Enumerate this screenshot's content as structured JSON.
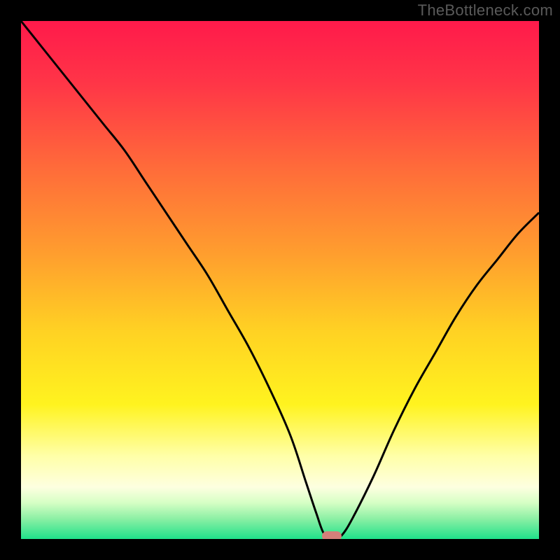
{
  "watermark": "TheBottleneck.com",
  "chart_data": {
    "type": "line",
    "title": "",
    "xlabel": "",
    "ylabel": "",
    "xlim": [
      0,
      100
    ],
    "ylim": [
      0,
      100
    ],
    "grid": false,
    "legend": false,
    "background": {
      "type": "vertical-gradient",
      "stops": [
        {
          "pct": 0,
          "color": "#ff1a4b"
        },
        {
          "pct": 12,
          "color": "#ff3547"
        },
        {
          "pct": 28,
          "color": "#ff6a3a"
        },
        {
          "pct": 45,
          "color": "#ff9e2e"
        },
        {
          "pct": 60,
          "color": "#ffd223"
        },
        {
          "pct": 74,
          "color": "#fff31f"
        },
        {
          "pct": 84,
          "color": "#ffffa8"
        },
        {
          "pct": 90,
          "color": "#fdffe0"
        },
        {
          "pct": 93,
          "color": "#d6ffc5"
        },
        {
          "pct": 96,
          "color": "#8ef0a5"
        },
        {
          "pct": 100,
          "color": "#1fe18a"
        }
      ]
    },
    "series": [
      {
        "name": "bottleneck-curve",
        "color": "#000000",
        "stroke_width": 3,
        "x": [
          0,
          4,
          8,
          12,
          16,
          20,
          24,
          28,
          32,
          36,
          40,
          44,
          48,
          52,
          55,
          57,
          58.5,
          60,
          61,
          62,
          64,
          68,
          72,
          76,
          80,
          84,
          88,
          92,
          96,
          100
        ],
        "y": [
          100,
          95,
          90,
          85,
          80,
          75,
          69,
          63,
          57,
          51,
          44,
          37,
          29,
          20,
          11,
          5,
          1,
          0.5,
          0.5,
          0.8,
          4,
          12,
          21,
          29,
          36,
          43,
          49,
          54,
          59,
          63
        ]
      }
    ],
    "marker": {
      "name": "optimal-point",
      "x": 60,
      "y": 0.5,
      "color": "#d47f7a"
    }
  }
}
